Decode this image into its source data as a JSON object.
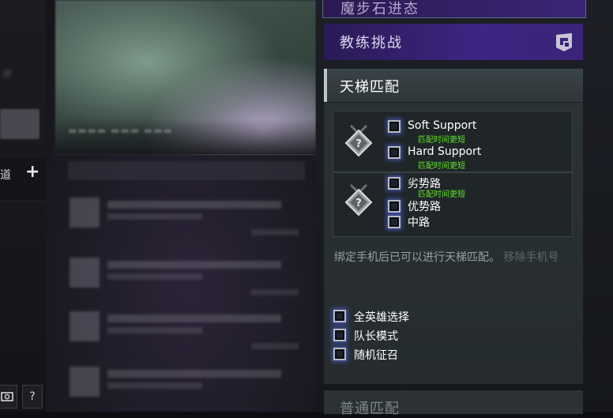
{
  "left": {
    "channel_label": "道",
    "add_icon": "plus-icon",
    "bottom_icons": [
      "screenshot-icon",
      "help-icon"
    ],
    "help_label": "?"
  },
  "right": {
    "top_banner": "魔步石进态",
    "coach_challenge": "教练挑战",
    "ranked": {
      "title": "天梯匹配",
      "roles": [
        {
          "label": "Soft Support",
          "hint": "匹配时间更短"
        },
        {
          "label": "Hard Support",
          "hint": "匹配时间更短"
        },
        {
          "label": "劣势路",
          "hint": "匹配时间更短"
        },
        {
          "label": "优势路",
          "hint": ""
        },
        {
          "label": "中路",
          "hint": ""
        }
      ],
      "bind_note": "绑定手机后已可以进行天梯匹配。",
      "remove_phone": "移除手机号",
      "options": [
        "全英雄选择",
        "队长模式",
        "随机征召"
      ]
    },
    "normal_match": "普通匹配"
  },
  "colors": {
    "accent_purple": "#3d2583",
    "hint_green": "#62e02a",
    "checkbox_glow": "#5a6eff"
  }
}
